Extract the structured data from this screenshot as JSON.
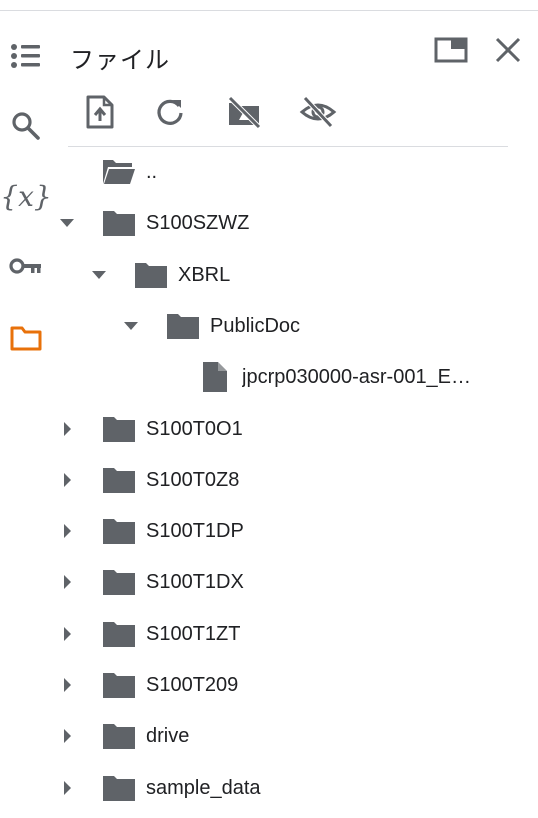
{
  "panel": {
    "title": "ファイル"
  },
  "colors": {
    "icon": "#5f6368",
    "active": "#e8710a",
    "folder": "#5f6368",
    "text": "#202124"
  },
  "rail": [
    {
      "name": "table-of-contents-icon",
      "active": false
    },
    {
      "name": "search-icon",
      "active": false
    },
    {
      "name": "variables-icon",
      "label": "{x}",
      "active": false
    },
    {
      "name": "secrets-key-icon",
      "active": false
    },
    {
      "name": "files-folder-icon",
      "active": true
    }
  ],
  "toolbar": [
    {
      "name": "upload-file-button",
      "icon": "upload-file-icon"
    },
    {
      "name": "refresh-button",
      "icon": "refresh-icon"
    },
    {
      "name": "mount-drive-button",
      "icon": "drive-off-icon"
    },
    {
      "name": "hidden-files-button",
      "icon": "visibility-off-icon"
    }
  ],
  "tree": [
    {
      "label": "..",
      "type": "folder-open",
      "level": 1,
      "arrow": "none"
    },
    {
      "label": "S100SZWZ",
      "type": "folder",
      "level": 1,
      "arrow": "down"
    },
    {
      "label": "XBRL",
      "type": "folder",
      "level": 2,
      "arrow": "down"
    },
    {
      "label": "PublicDoc",
      "type": "folder",
      "level": 3,
      "arrow": "down"
    },
    {
      "label": "jpcrp030000-asr-001_E…",
      "type": "file",
      "level": 4,
      "arrow": "none"
    },
    {
      "label": "S100T0O1",
      "type": "folder",
      "level": 1,
      "arrow": "right"
    },
    {
      "label": "S100T0Z8",
      "type": "folder",
      "level": 1,
      "arrow": "right"
    },
    {
      "label": "S100T1DP",
      "type": "folder",
      "level": 1,
      "arrow": "right"
    },
    {
      "label": "S100T1DX",
      "type": "folder",
      "level": 1,
      "arrow": "right"
    },
    {
      "label": "S100T1ZT",
      "type": "folder",
      "level": 1,
      "arrow": "right"
    },
    {
      "label": "S100T209",
      "type": "folder",
      "level": 1,
      "arrow": "right"
    },
    {
      "label": "drive",
      "type": "folder",
      "level": 1,
      "arrow": "right"
    },
    {
      "label": "sample_data",
      "type": "folder",
      "level": 1,
      "arrow": "right"
    }
  ]
}
